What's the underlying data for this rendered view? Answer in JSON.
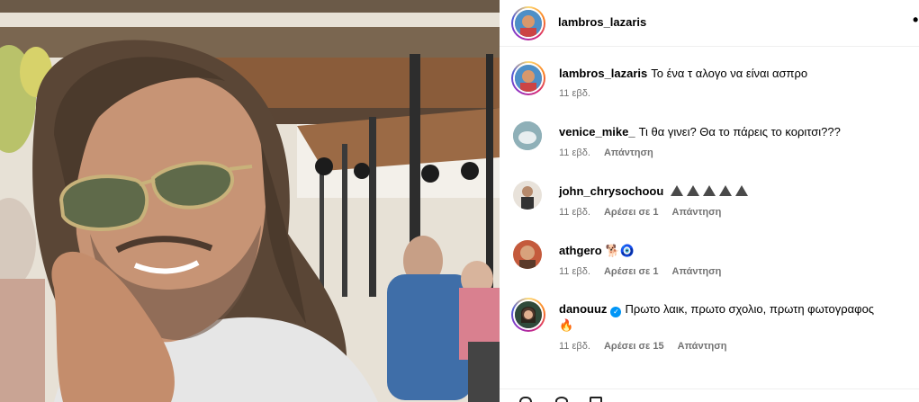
{
  "post": {
    "author": "lambros_lazaris",
    "more_icon": "more-icon"
  },
  "comments": [
    {
      "username": "lambros_lazaris",
      "text": "Το ένα τ αλογο να είναι ασπρο",
      "time": "11 εβδ.",
      "likes": "",
      "reply": ""
    },
    {
      "username": "venice_mike_",
      "text": "Τι θα γινει? Θα το πάρεις το κοριτσι???",
      "time": "11 εβδ.",
      "likes": "",
      "reply": "Απάντηση"
    },
    {
      "username": "john_chrysochoou",
      "text": "",
      "time": "11 εβδ.",
      "likes": "Αρέσει σε 1",
      "reply": "Απάντηση"
    },
    {
      "username": "athgero",
      "text": "🐕🧿",
      "time": "11 εβδ.",
      "likes": "Αρέσει σε 1",
      "reply": "Απάντηση"
    },
    {
      "username": "danouuz",
      "text": "Πρωτο λαικ, πρωτο σχολιο, πρωτη φωτογραφος",
      "text2": "🔥",
      "time": "11 εβδ.",
      "likes": "Αρέσει σε 15",
      "reply": "Απάντηση"
    }
  ]
}
